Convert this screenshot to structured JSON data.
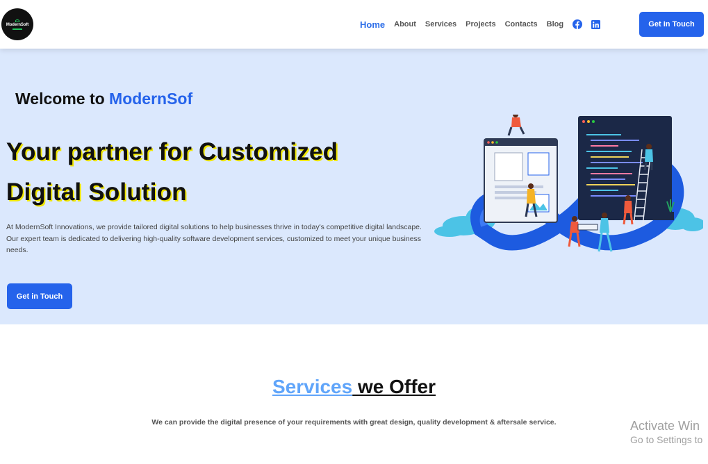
{
  "navbar": {
    "logo_text": "ModernSoft",
    "links": [
      {
        "label": "Home",
        "active": true
      },
      {
        "label": "About"
      },
      {
        "label": "Services"
      },
      {
        "label": "Projects"
      },
      {
        "label": "Contacts"
      },
      {
        "label": "Blog"
      }
    ],
    "social_icons": [
      "facebook-icon",
      "linkedin-icon"
    ],
    "cta_label": "Get in Touch"
  },
  "hero": {
    "welcome_prefix": "Welcome to ",
    "welcome_brand": "ModernSof",
    "headline_line1": "Your partner for Customized",
    "headline_line2": "Digital Solution",
    "description": "At ModernSoft Innovations, we provide tailored digital solutions to help businesses thrive in today's competitive digital landscape. Our expert team is dedicated to delivering high-quality software development services, customized to meet your unique business needs.",
    "cta_label": "Get in Touch"
  },
  "services": {
    "title_accent": "Services",
    "title_rest": " we Offer",
    "subtitle": "We can provide the digital presence of your requirements with great design, quality development & aftersale service."
  },
  "watermark": {
    "title": "Activate Win",
    "subtitle": "Go to Settings to"
  },
  "colors": {
    "brand_blue": "#2563eb",
    "hero_bg": "#dbe8fd",
    "services_accent": "#60a5fa"
  }
}
